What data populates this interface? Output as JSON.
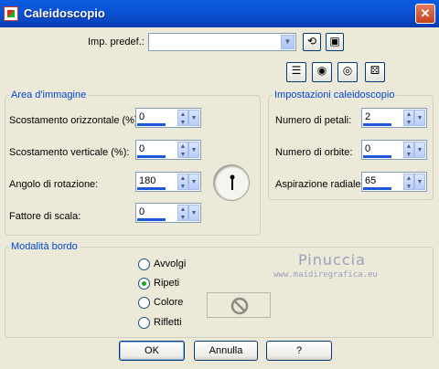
{
  "window": {
    "title": "Caleidoscopio",
    "close_glyph": "✕"
  },
  "preset": {
    "label": "Imp. predef.:",
    "value": "",
    "icons": [
      "reset-icon",
      "save-icon"
    ]
  },
  "toolbar": {
    "icons": [
      "layout-icon",
      "eye-preview-icon",
      "eye-toggle-icon",
      "dice-randomize-icon"
    ]
  },
  "area": {
    "title": "Area d'immagine",
    "fields": [
      {
        "label": "Scostamento orizzontale (%):",
        "value": "0"
      },
      {
        "label": "Scostamento verticale (%):",
        "value": "0"
      },
      {
        "label": "Angolo di rotazione:",
        "value": "180"
      },
      {
        "label": "Fattore di scala:",
        "value": "0"
      }
    ]
  },
  "impostazioni": {
    "title": "Impostazioni caleidoscopio",
    "fields": [
      {
        "label": "Numero di petali:",
        "value": "2"
      },
      {
        "label": "Numero di orbite:",
        "value": "0"
      },
      {
        "label": "Aspirazione radiale:",
        "value": "65"
      }
    ]
  },
  "bordo": {
    "title": "Modalità bordo",
    "options": [
      {
        "label": "Avvolgi",
        "checked": false
      },
      {
        "label": "Ripeti",
        "checked": true
      },
      {
        "label": "Colore",
        "checked": false
      },
      {
        "label": "Rifletti",
        "checked": false
      }
    ]
  },
  "watermark": {
    "name": "Pinuccia",
    "url": "www.maidiregrafica.eu"
  },
  "buttons": {
    "ok": "OK",
    "cancel": "Annulla",
    "help": "?"
  },
  "colors": {
    "accent": "#0046d5",
    "titlebar": "#0b53d6",
    "spin_bar": "#1d58d8"
  }
}
